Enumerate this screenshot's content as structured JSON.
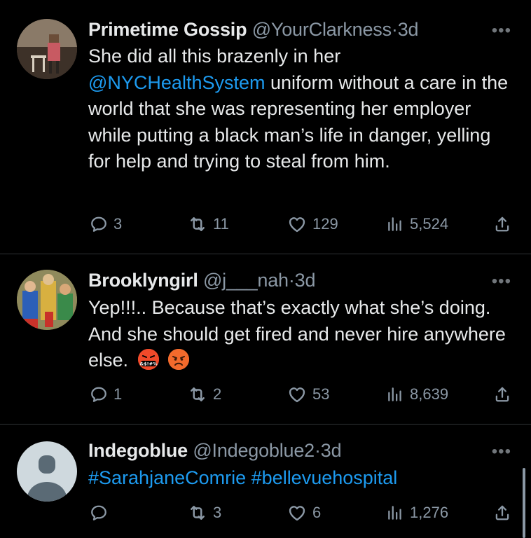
{
  "tweets": [
    {
      "name": "Primetime Gossip",
      "handle": "@YourClarkness",
      "dot": "·",
      "time": "3d",
      "text_before": "She did all this brazenly in her",
      "mention": "@NYCHealthSystem",
      "text_after": " uniform without a care in the world that she was representing her employer while putting a black man’s life in danger, yelling for help and trying to steal from him.",
      "replies": "3",
      "retweets": "11",
      "likes": "129",
      "views": "5,524"
    },
    {
      "name": "Brooklyngirl",
      "handle": "@j___nah",
      "dot": "·",
      "time": "3d",
      "text": "Yep!!!.. Because that’s exactly what she’s doing. And she should get fired and never hire anywhere else.",
      "emoji1_text": "&$!#%",
      "replies": "1",
      "retweets": "2",
      "likes": "53",
      "views": "8,639"
    },
    {
      "name": "Indegoblue",
      "handle": "@Indegoblue2",
      "dot": "·",
      "time": "3d",
      "hashtag1": "#SarahjaneComrie",
      "hashtag2": "#bellevuehospital",
      "replies": "",
      "retweets": "3",
      "likes": "6",
      "views": "1,276"
    }
  ],
  "more_label": "•••",
  "icons": [
    "reply-icon",
    "retweet-icon",
    "like-icon",
    "views-icon",
    "share-icon",
    "more-icon"
  ],
  "colors": {
    "background": "#000000",
    "text": "#e7e9ea",
    "muted": "#8b98a5",
    "link": "#1d9bf0",
    "divider": "#2f3336"
  }
}
